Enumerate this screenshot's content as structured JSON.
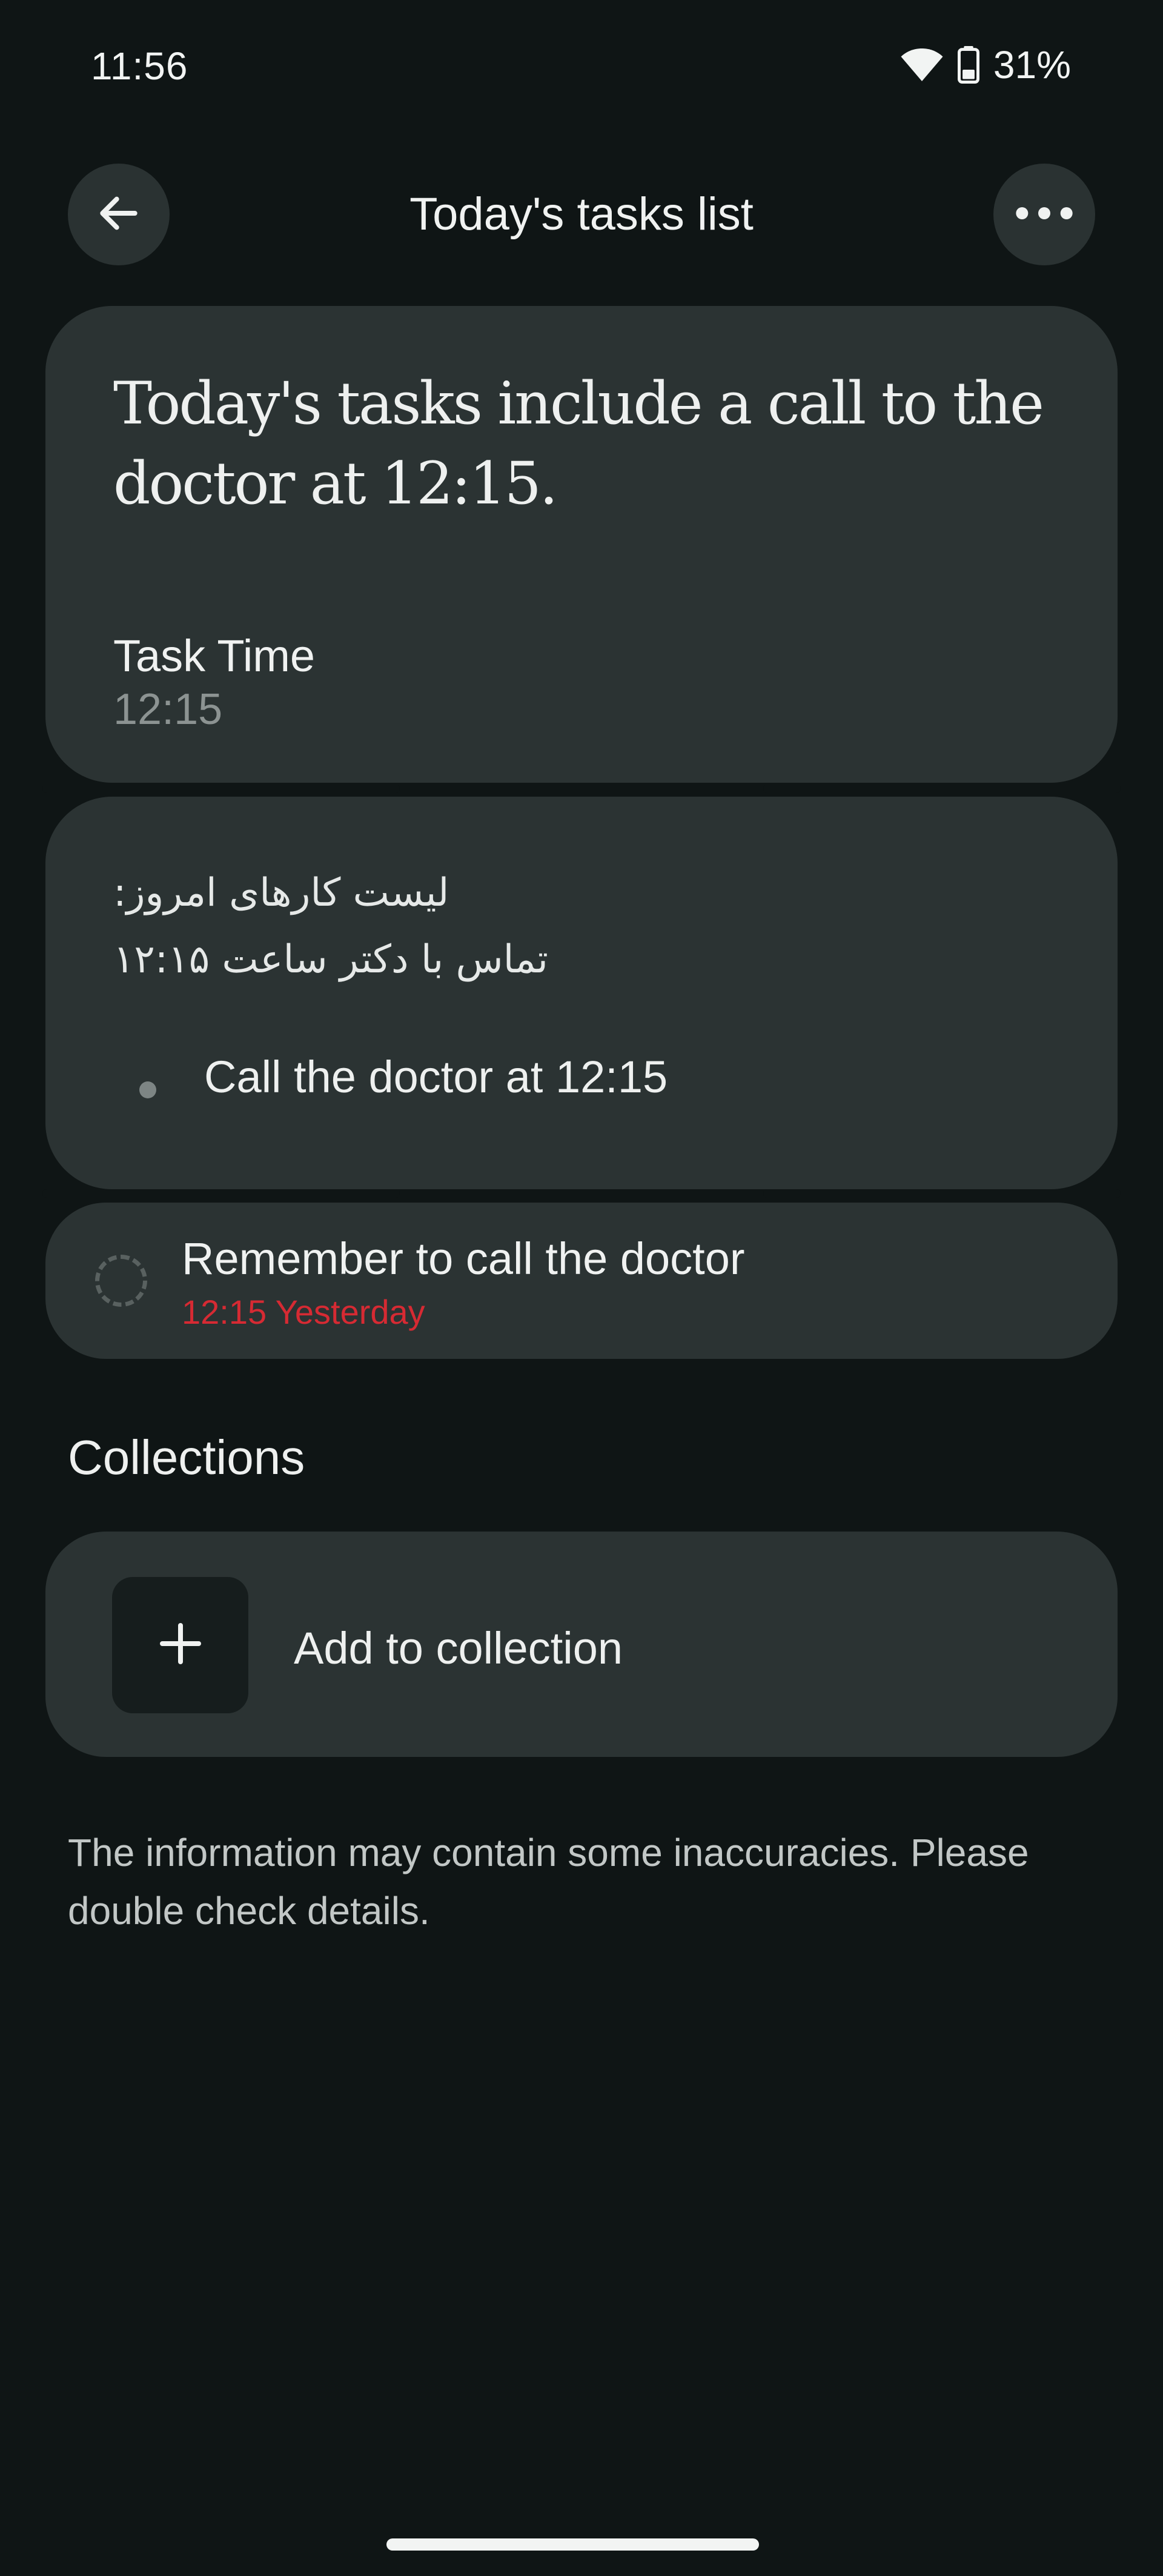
{
  "status_bar": {
    "time": "11:56",
    "battery": "31%",
    "icons": [
      "wifi-icon",
      "battery-icon"
    ]
  },
  "header": {
    "title": "Today's tasks list",
    "back_icon": "arrow-left-icon",
    "more_icon": "more-horizontal-icon"
  },
  "summary": {
    "text": "Today's tasks include a call to the doctor at 12:15.",
    "task_time_label": "Task Time",
    "task_time_value": "12:15"
  },
  "details": {
    "fa_line1": "لیست کارهای امروز:",
    "fa_line2": "تماس با دکتر ساعت ۱۲:۱۵",
    "bullets": [
      "Call the doctor at 12:15"
    ]
  },
  "reminder": {
    "title": "Remember to call the doctor",
    "subtitle": "12:15 Yesterday",
    "subtitle_color": "#d62a33"
  },
  "collections": {
    "section_title": "Collections",
    "add_label": "Add to collection",
    "add_icon": "plus-icon"
  },
  "disclaimer": "The information may contain some inaccuracies. Please double check details.",
  "colors": {
    "background": "#0f1515",
    "card": "#2b3333",
    "accent_red": "#d62a33"
  }
}
